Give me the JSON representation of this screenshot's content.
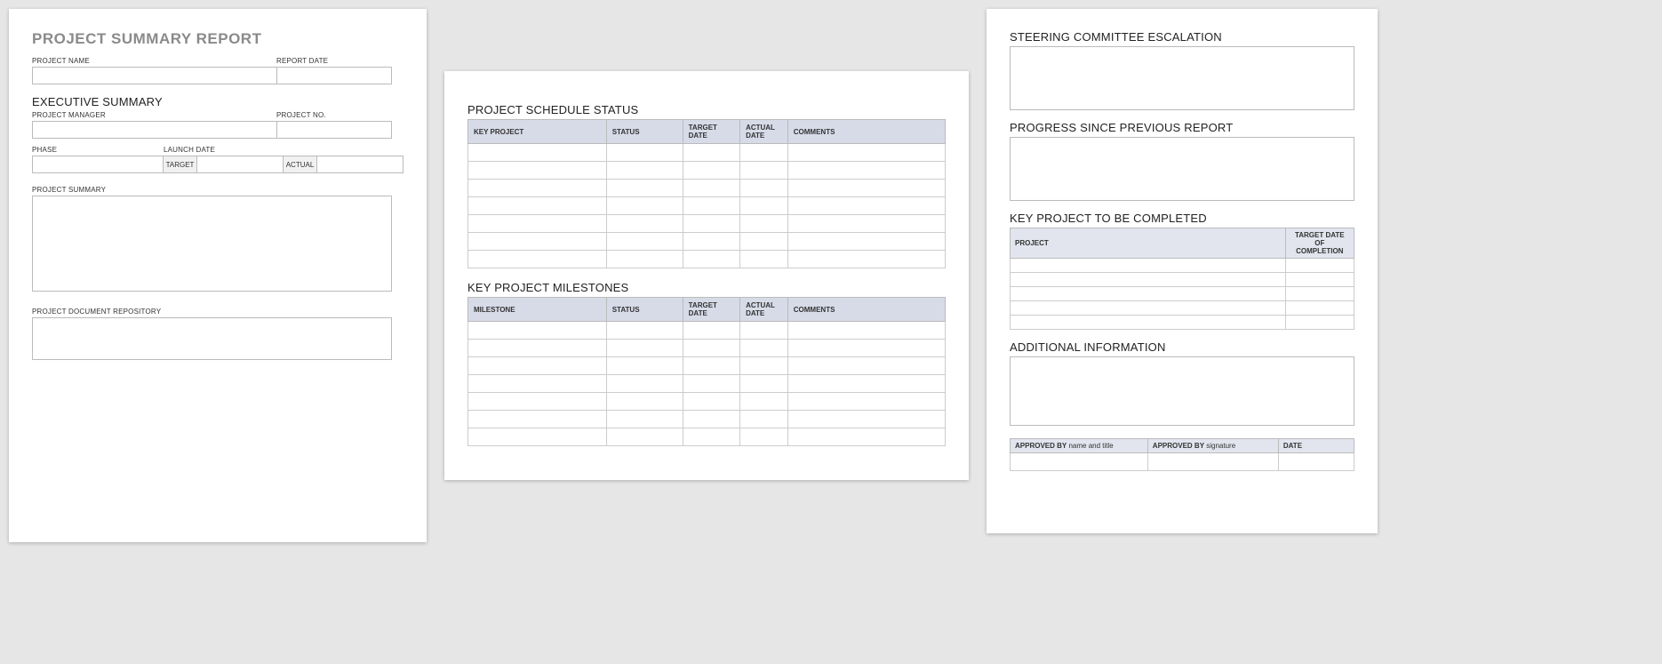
{
  "page1": {
    "title": "PROJECT SUMMARY REPORT",
    "labels": {
      "project_name": "PROJECT NAME",
      "report_date": "REPORT DATE",
      "executive_summary": "EXECUTIVE SUMMARY",
      "project_manager": "PROJECT MANAGER",
      "project_no": "PROJECT NO.",
      "phase": "PHASE",
      "launch_date": "LAUNCH DATE",
      "target": "TARGET",
      "actual": "ACTUAL",
      "project_summary": "PROJECT SUMMARY",
      "repository": "PROJECT DOCUMENT REPOSITORY"
    }
  },
  "page2": {
    "schedule_title": "PROJECT SCHEDULE STATUS",
    "milestones_title": "KEY PROJECT MILESTONES",
    "headers": {
      "key_project": "KEY PROJECT",
      "milestone": "MILESTONE",
      "status": "STATUS",
      "target_date": "TARGET DATE",
      "actual_date": "ACTUAL DATE",
      "comments": "COMMENTS"
    },
    "schedule_rows": 7,
    "milestone_rows": 7
  },
  "page3": {
    "escalation_title": "STEERING COMMITTEE ESCALATION",
    "progress_title": "PROGRESS SINCE PREVIOUS REPORT",
    "key_project_title": "KEY PROJECT TO BE COMPLETED",
    "additional_title": "ADDITIONAL INFORMATION",
    "kp_headers": {
      "project": "PROJECT",
      "target_date": "TARGET DATE OF COMPLETION"
    },
    "kp_rows": 5,
    "approve": {
      "col1_bold": "APPROVED BY",
      "col1_light": " name and title",
      "col2_bold": "APPROVED BY",
      "col2_light": " signature",
      "col3": "DATE"
    }
  }
}
